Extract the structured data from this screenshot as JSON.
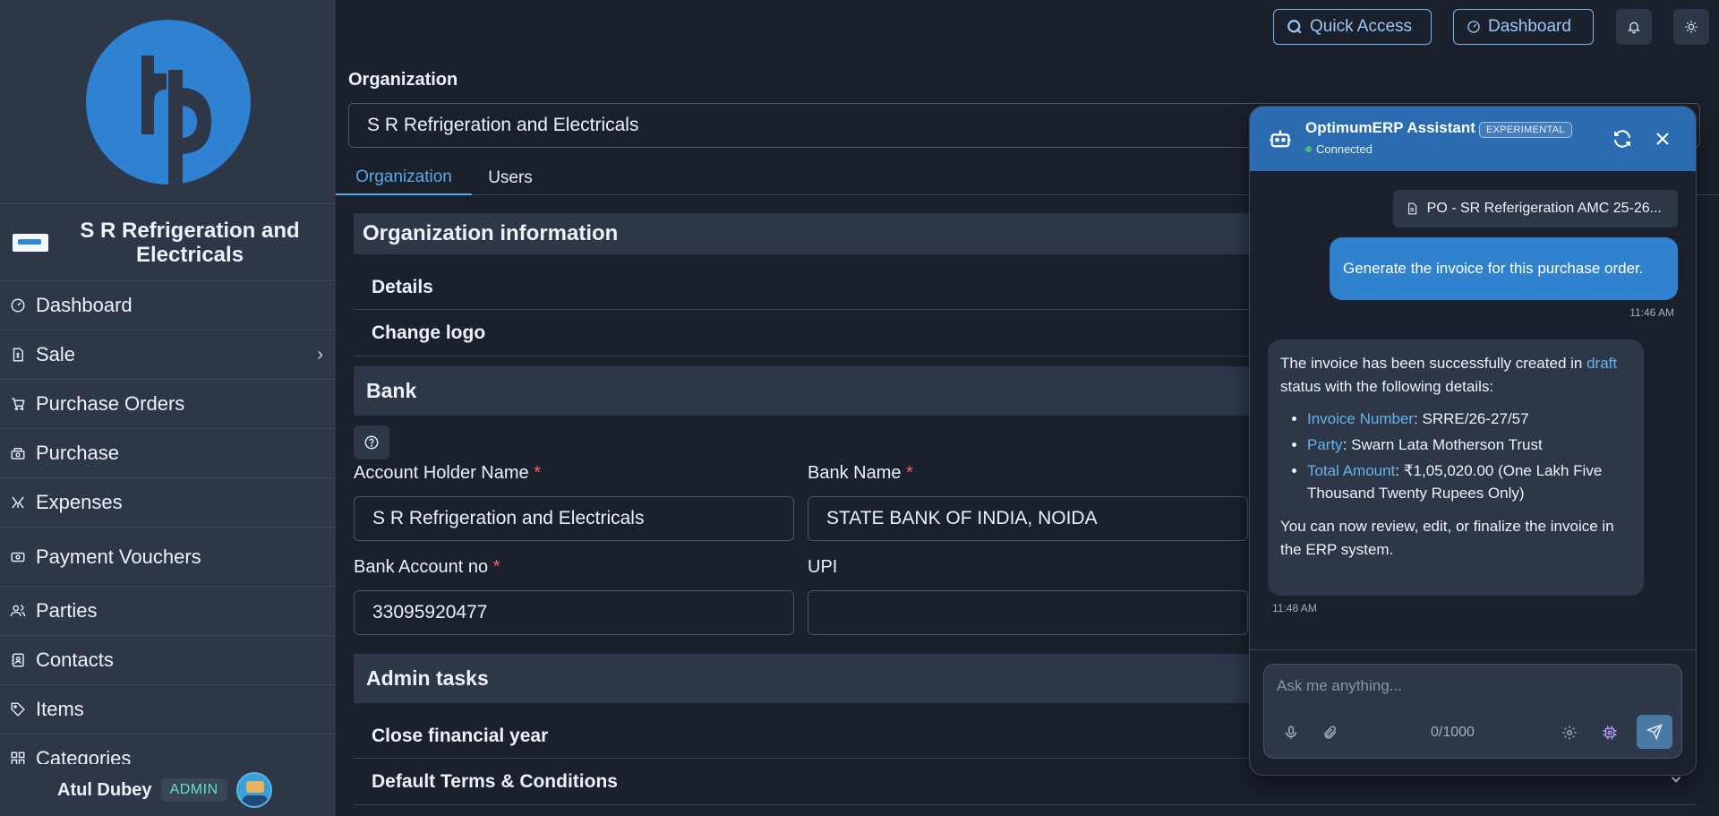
{
  "topbar": {
    "quick_access_label": "Quick Access",
    "dashboard_label": "Dashboard"
  },
  "sidebar": {
    "org_name": "S R Refrigeration and Electricals",
    "items": [
      {
        "label": "Dashboard",
        "icon": "gauge-icon"
      },
      {
        "label": "Sale",
        "icon": "invoice-icon",
        "has_children": true
      },
      {
        "label": "Purchase Orders",
        "icon": "cart-icon"
      },
      {
        "label": "Purchase",
        "icon": "money-icon"
      },
      {
        "label": "Expenses",
        "icon": "expenses-icon"
      },
      {
        "label": "Payment Vouchers",
        "icon": "voucher-icon"
      },
      {
        "label": "Parties",
        "icon": "users-icon"
      },
      {
        "label": "Contacts",
        "icon": "contacts-icon"
      },
      {
        "label": "Items",
        "icon": "tag-icon"
      },
      {
        "label": "Categories",
        "icon": "grid-icon"
      }
    ],
    "user": {
      "name": "Atul Dubey",
      "role": "ADMIN"
    }
  },
  "main": {
    "org_label": "Organization",
    "org_value": "S R Refrigeration and Electricals",
    "tabs": [
      {
        "label": "Organization",
        "active": true
      },
      {
        "label": "Users",
        "active": false
      }
    ],
    "org_info": {
      "title": "Organization information",
      "rows": [
        "Details",
        "Change logo"
      ]
    },
    "bank": {
      "title": "Bank",
      "account_holder_label": "Account Holder Name",
      "account_holder_value": "S R Refrigeration and Electricals",
      "bank_name_label": "Bank Name",
      "bank_name_value": "STATE BANK OF INDIA, NOIDA",
      "account_no_label": "Bank Account no",
      "account_no_value": "33095920477",
      "upi_label": "UPI",
      "upi_value": "",
      "required_mark": "*"
    },
    "admin_tasks": {
      "title": "Admin tasks",
      "rows": [
        "Close financial year",
        "Default Terms & Conditions"
      ]
    }
  },
  "chat": {
    "title": "OptimumERP Assistant",
    "badge": "EXPERIMENTAL",
    "status": "Connected",
    "attachment": "PO - SR Referigeration AMC 25-26...",
    "user_message": "Generate the invoice for this purchase order.",
    "user_time": "11:46 AM",
    "bot": {
      "intro_pre": "The invoice has been successfully created in ",
      "intro_hl": "draft",
      "intro_post": " status with the following details:",
      "details": [
        {
          "key": "Invoice Number",
          "value": ": SRRE/26-27/57"
        },
        {
          "key": "Party",
          "value": ": Swarn Lata Motherson Trust"
        },
        {
          "key": "Total Amount",
          "value": ": ₹1,05,020.00 (One Lakh Five Thousand Twenty Rupees Only)"
        }
      ],
      "outro": "You can now review, edit, or finalize the invoice in the ERP system."
    },
    "bot_time": "11:48 AM",
    "input_placeholder": "Ask me anything...",
    "counter": "0/1000"
  },
  "colors": {
    "accent": "#3182ce",
    "sidebar_bg": "#2d3748",
    "page_bg": "#1a202c",
    "required": "#f56565"
  }
}
